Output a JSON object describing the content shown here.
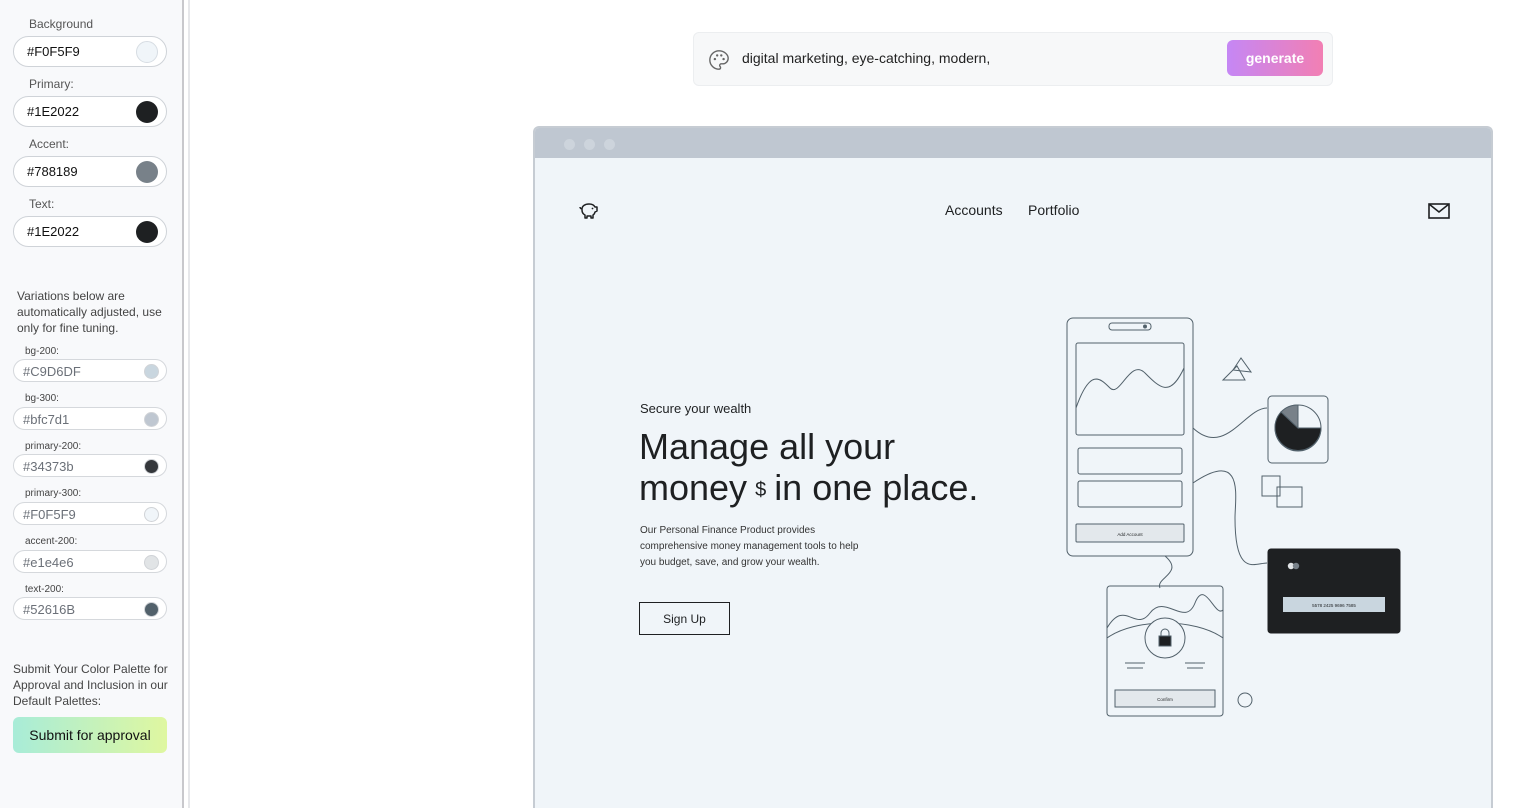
{
  "sidebar": {
    "main_colors": [
      {
        "label": "Background",
        "value": "#F0F5F9",
        "color": "#F0F5F9"
      },
      {
        "label": "Primary:",
        "value": "#1E2022",
        "color": "#1E2022"
      },
      {
        "label": "Accent:",
        "value": "#788189",
        "color": "#788189"
      },
      {
        "label": "Text:",
        "value": "#1E2022",
        "color": "#1E2022"
      }
    ],
    "note": "Variations below are automatically adjusted, use only for fine tuning.",
    "variations": [
      {
        "label": "bg-200:",
        "value": "#C9D6DF",
        "color": "#C9D6DF"
      },
      {
        "label": "bg-300:",
        "value": "#bfc7d1",
        "color": "#bfc7d1"
      },
      {
        "label": "primary-200:",
        "value": "#34373b",
        "color": "#34373b"
      },
      {
        "label": "primary-300:",
        "value": "#F0F5F9",
        "color": "#F0F5F9"
      },
      {
        "label": "accent-200:",
        "value": "#e1e4e6",
        "color": "#e1e4e6"
      },
      {
        "label": "text-200:",
        "value": "#52616B",
        "color": "#52616B"
      }
    ],
    "submit_note": "Submit Your Color Palette for Approval and Inclusion in our Default Palettes:",
    "submit_label": "Submit for approval"
  },
  "prompt": {
    "icon": "palette-icon",
    "value": "digital marketing, eye-catching, modern,",
    "generate_label": "generate"
  },
  "preview": {
    "nav": {
      "logo_icon": "piggy-bank-icon",
      "links": [
        "Accounts",
        "Portfolio"
      ],
      "mail_icon": "mail-icon"
    },
    "hero": {
      "eyebrow": "Secure your wealth",
      "headline_1": "Manage all your",
      "headline_2a": "money",
      "headline_symbol": "$",
      "headline_2b": "in one place.",
      "description": "Our Personal Finance Product provides comprehensive money management tools to help you budget, save, and grow your wealth.",
      "cta": "Sign Up"
    },
    "illustration": {
      "phone_button": "Add Account",
      "card_number": "5578 2425 9696 7585",
      "confirm_label": "Confirm"
    }
  }
}
